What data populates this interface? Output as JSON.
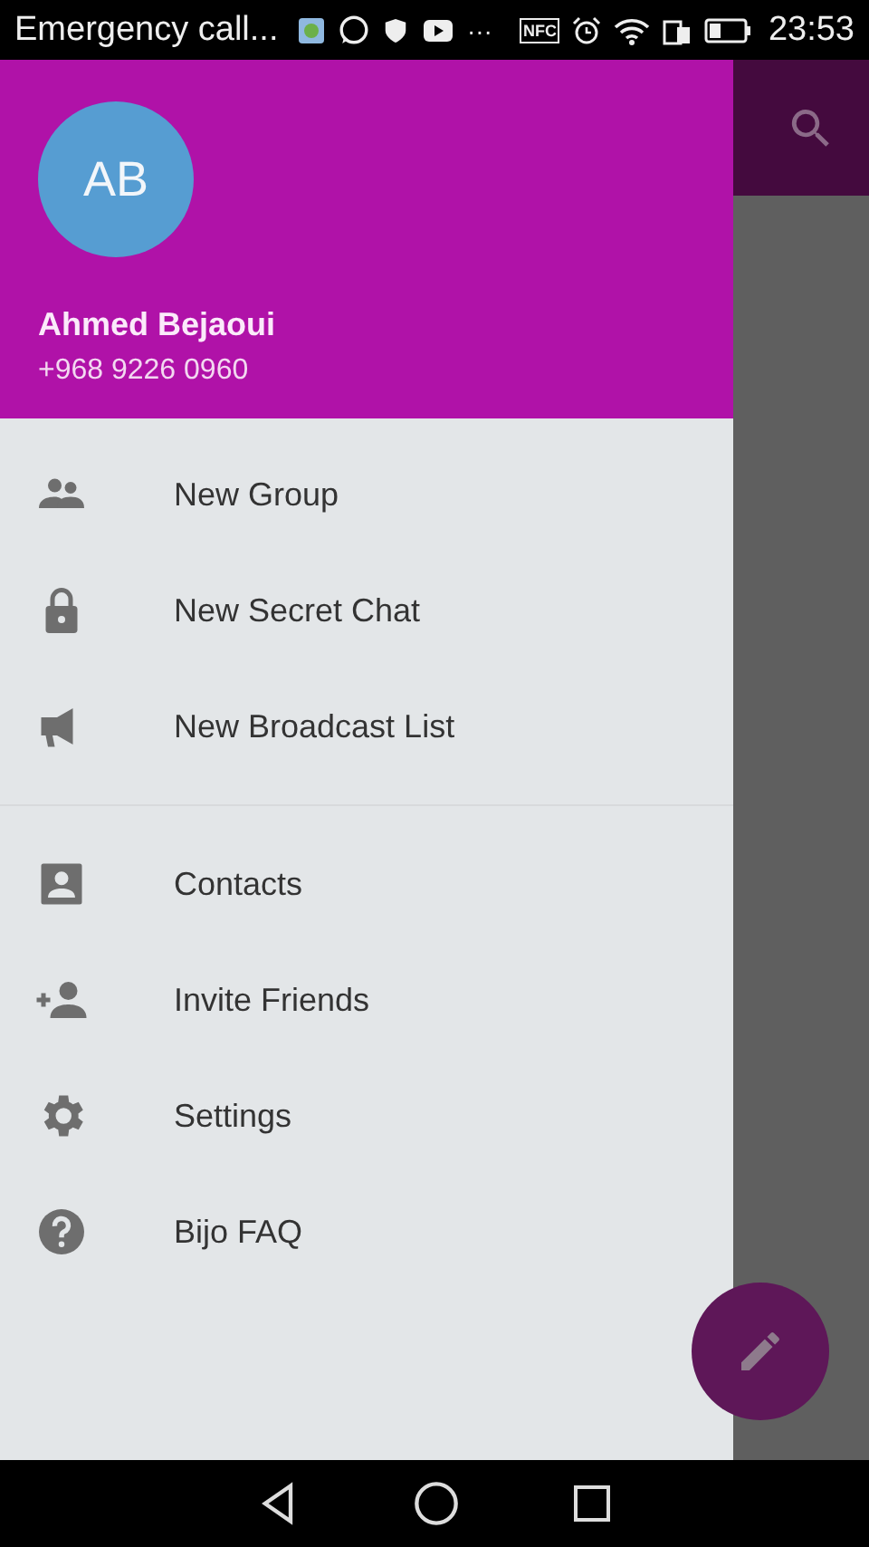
{
  "status_bar": {
    "text": "Emergency call...",
    "more": "···",
    "nfc": "NFC",
    "time": "23:53"
  },
  "drawer": {
    "avatar_initials": "AB",
    "name": "Ahmed Bejaoui",
    "phone": "+968 9226 0960",
    "sections": [
      {
        "items": [
          {
            "label": "New Group",
            "kind": "group"
          },
          {
            "label": "New Secret Chat",
            "kind": "lock"
          },
          {
            "label": "New Broadcast List",
            "kind": "megaphone"
          }
        ]
      },
      {
        "items": [
          {
            "label": "Contacts",
            "kind": "contact"
          },
          {
            "label": "Invite Friends",
            "kind": "invite"
          },
          {
            "label": "Settings",
            "kind": "settings"
          },
          {
            "label": "Bijo FAQ",
            "kind": "help"
          }
        ]
      }
    ]
  }
}
